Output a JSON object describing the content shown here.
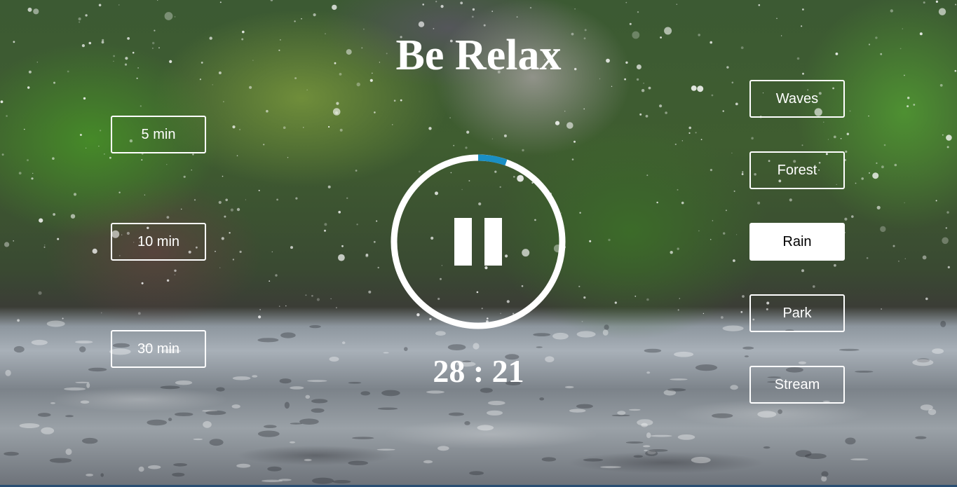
{
  "app": {
    "title": "Be Relax"
  },
  "durations": [
    {
      "label": "5 min"
    },
    {
      "label": "10 min"
    },
    {
      "label": "30 min"
    }
  ],
  "sounds": [
    {
      "label": "Waves",
      "active": false
    },
    {
      "label": "Forest",
      "active": false
    },
    {
      "label": "Rain",
      "active": true
    },
    {
      "label": "Park",
      "active": false
    },
    {
      "label": "Stream",
      "active": false
    }
  ],
  "player": {
    "state": "playing",
    "control_icon": "pause-icon",
    "progress_fraction": 0.054,
    "track_color": "#ffffff",
    "progress_color": "#1a8fc4"
  },
  "timer": {
    "display": "28 : 21"
  },
  "background": "rain-on-ground-photo"
}
